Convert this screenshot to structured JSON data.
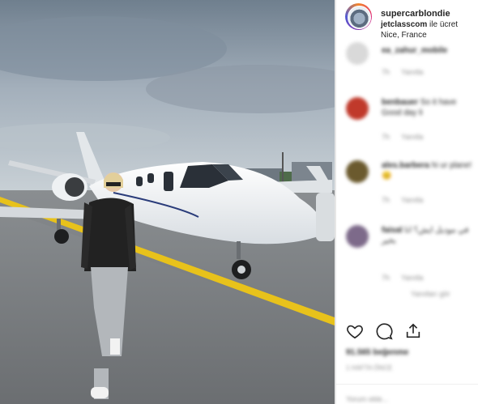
{
  "post": {
    "username": "supercarblondie",
    "sponsor_account": "jetclasscom",
    "sponsor_suffix": "ile ücret",
    "location": "Nice, France"
  },
  "comments": [
    {
      "name": "ea_zahur_mobile",
      "text": "",
      "time": "7h",
      "reply": "Yanıtla",
      "avatar_color": "#d9d9d9"
    },
    {
      "name": "benbauer",
      "text": "So it have Good day li",
      "time": "7h",
      "reply": "Yanıtla",
      "avatar_color": "#c0392b"
    },
    {
      "name": "ales.barbera",
      "text": "hi ur plane! 😊",
      "time": "7h",
      "reply": "Yanıtla",
      "avatar_color": "#6b5a2e"
    },
    {
      "name": "faisal",
      "text": "في موديل ايش؟ انا بخير",
      "time": "7h",
      "reply": "Yanıtla",
      "extra": "Yanıtları gör",
      "avatar_color": "#7d6a8a"
    }
  ],
  "actions": {
    "like_icon": "heart-icon",
    "comment_icon": "comment-icon",
    "share_icon": "share-icon",
    "likes_text": "91.565 beğenme",
    "time_ago": "1 HAFTA ÖNCE",
    "add_comment_placeholder": "Yorum ekle..."
  }
}
